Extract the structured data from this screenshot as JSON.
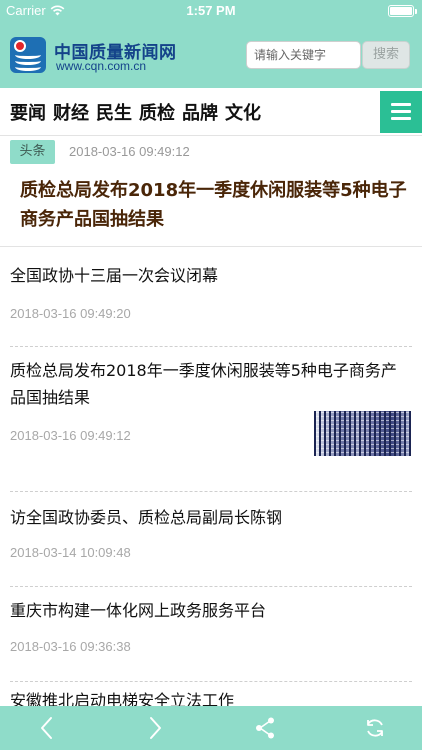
{
  "status_bar": {
    "carrier": "Carrier",
    "time": "1:57 PM"
  },
  "header": {
    "logo_title": "中国质量新闻网",
    "logo_url": "www.cqn.com.cn",
    "search_placeholder": "请输入关键字",
    "search_button": "搜索"
  },
  "nav": {
    "items": [
      "要闻",
      "财经",
      "民生",
      "质检",
      "品牌",
      "文化"
    ]
  },
  "headline": {
    "tag": "头条",
    "date": "2018-03-16 09:49:12",
    "title": "质检总局发布2018年一季度休闲服装等5种电子商务产品国抽结果"
  },
  "news": [
    {
      "title": "全国政协十三届一次会议闭幕",
      "date": "2018-03-16 09:49:20"
    },
    {
      "title": "质检总局发布2018年一季度休闲服装等5种电子商务产品国抽结果",
      "date": "2018-03-16 09:49:12"
    },
    {
      "title": "访全国政协委员、质检总局副局长陈钢",
      "date": "2018-03-14 10:09:48"
    },
    {
      "title": "重庆市构建一体化网上政务服务平台",
      "date": "2018-03-16 09:36:38"
    },
    {
      "title": "安徽推北启动电梯安全立法工作",
      "date": ""
    }
  ],
  "toolbar": {
    "icons": [
      "chevron-left-icon",
      "chevron-right-icon",
      "share-icon",
      "refresh-icon"
    ]
  },
  "colors": {
    "theme": "#8fdcc9",
    "menu_button": "#2bbf95",
    "headline_title": "#4a2608",
    "logo_text": "#14438a"
  }
}
